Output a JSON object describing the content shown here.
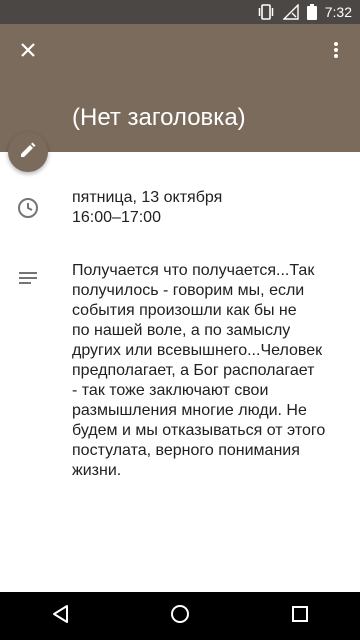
{
  "status_bar": {
    "time": "7:32",
    "icons": [
      "vibrate-icon",
      "no-signal-icon",
      "battery-icon"
    ]
  },
  "header": {
    "title": "(Нет заголовка)",
    "background_color": "#7b6b5c"
  },
  "event": {
    "date": "пятница, 13 октября",
    "time_range": "16:00–17:00",
    "description_lines": [
      "Получается что получается...Так",
      "получилось - говорим мы, если",
      "события произошли как бы не",
      "по нашей воле, а по замыслу",
      "других или всевышнего...Человек",
      "предполагает, а Бог располагает",
      "- так тоже заключают свои",
      "размышления многие люди. Не",
      "будем и мы отказываться от этого",
      "постулата, верного понимания",
      "жизни."
    ]
  },
  "icons": {
    "close": "close-icon",
    "more": "more-vert-icon",
    "edit": "edit-pencil-icon",
    "time": "clock-icon",
    "description": "notes-icon",
    "nav_back": "back-icon",
    "nav_home": "home-icon",
    "nav_recents": "recents-icon"
  }
}
